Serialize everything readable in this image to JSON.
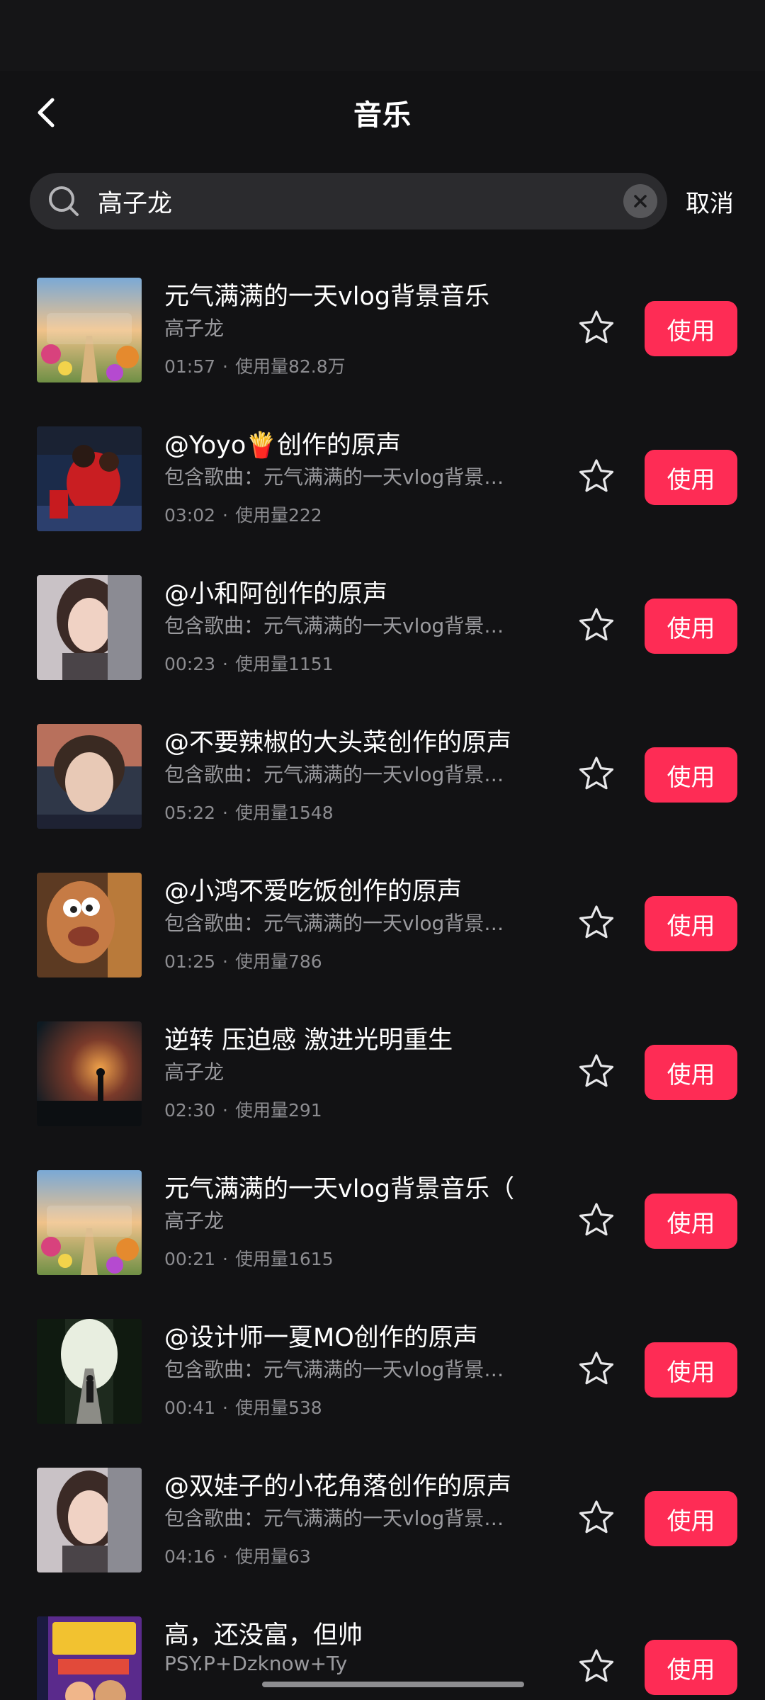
{
  "header": {
    "title": "音乐",
    "back_icon": "chevron-left-icon"
  },
  "search": {
    "value": "高子龙",
    "clear_icon": "close-icon",
    "cancel_label": "取消"
  },
  "accent_color": "#fe2c55",
  "results": [
    {
      "title": "元气满满的一天vlog背景音乐",
      "subtitle": "高子龙",
      "duration": "01:57",
      "usage": "使用量82.8万",
      "use_label": "使用",
      "thumb": "flower-path-artwork"
    },
    {
      "title": "@Yoyo🍟创作的原声",
      "subtitle": "包含歌曲：元气满满的一天vlog背景…",
      "duration": "03:02",
      "usage": "使用量222",
      "use_label": "使用",
      "thumb": "ping-pong-players-photo"
    },
    {
      "title": "@小和阿创作的原声",
      "subtitle": "包含歌曲：元气满满的一天vlog背景…",
      "duration": "00:23",
      "usage": "使用量1151",
      "use_label": "使用",
      "thumb": "woman-portrait-photo"
    },
    {
      "title": "@不要辣椒的大头菜创作的原声",
      "subtitle": "包含歌曲：元气满满的一天vlog背景…",
      "duration": "05:22",
      "usage": "使用量1548",
      "use_label": "使用",
      "thumb": "selfie-portrait-photo"
    },
    {
      "title": "@小鸿不爱吃饭创作的原声",
      "subtitle": "包含歌曲：元气满满的一天vlog背景…",
      "duration": "01:25",
      "usage": "使用量786",
      "use_label": "使用",
      "thumb": "cartoon-character-image"
    },
    {
      "title": "逆转 压迫感 激进光明重生",
      "subtitle": "高子龙",
      "duration": "02:30",
      "usage": "使用量291",
      "use_label": "使用",
      "thumb": "sunset-silhouette-artwork"
    },
    {
      "title": "元气满满的一天vlog背景音乐（",
      "subtitle": "高子龙",
      "duration": "00:21",
      "usage": "使用量1615",
      "use_label": "使用",
      "thumb": "flower-path-artwork"
    },
    {
      "title": "@设计师一夏MO创作的原声",
      "subtitle": "包含歌曲：元气满满的一天vlog背景…",
      "duration": "00:41",
      "usage": "使用量538",
      "use_label": "使用",
      "thumb": "tree-path-photo"
    },
    {
      "title": "@双娃子的小花角落创作的原声",
      "subtitle": "包含歌曲：元气满满的一天vlog背景…",
      "duration": "04:16",
      "usage": "使用量63",
      "use_label": "使用",
      "thumb": "woman-portrait-photo"
    },
    {
      "title": "高，还没富，但帅",
      "subtitle": "PSY.P+Dzknow+Ty",
      "duration": "",
      "usage": "",
      "use_label": "使用",
      "thumb": "mvp-album-cover"
    }
  ]
}
